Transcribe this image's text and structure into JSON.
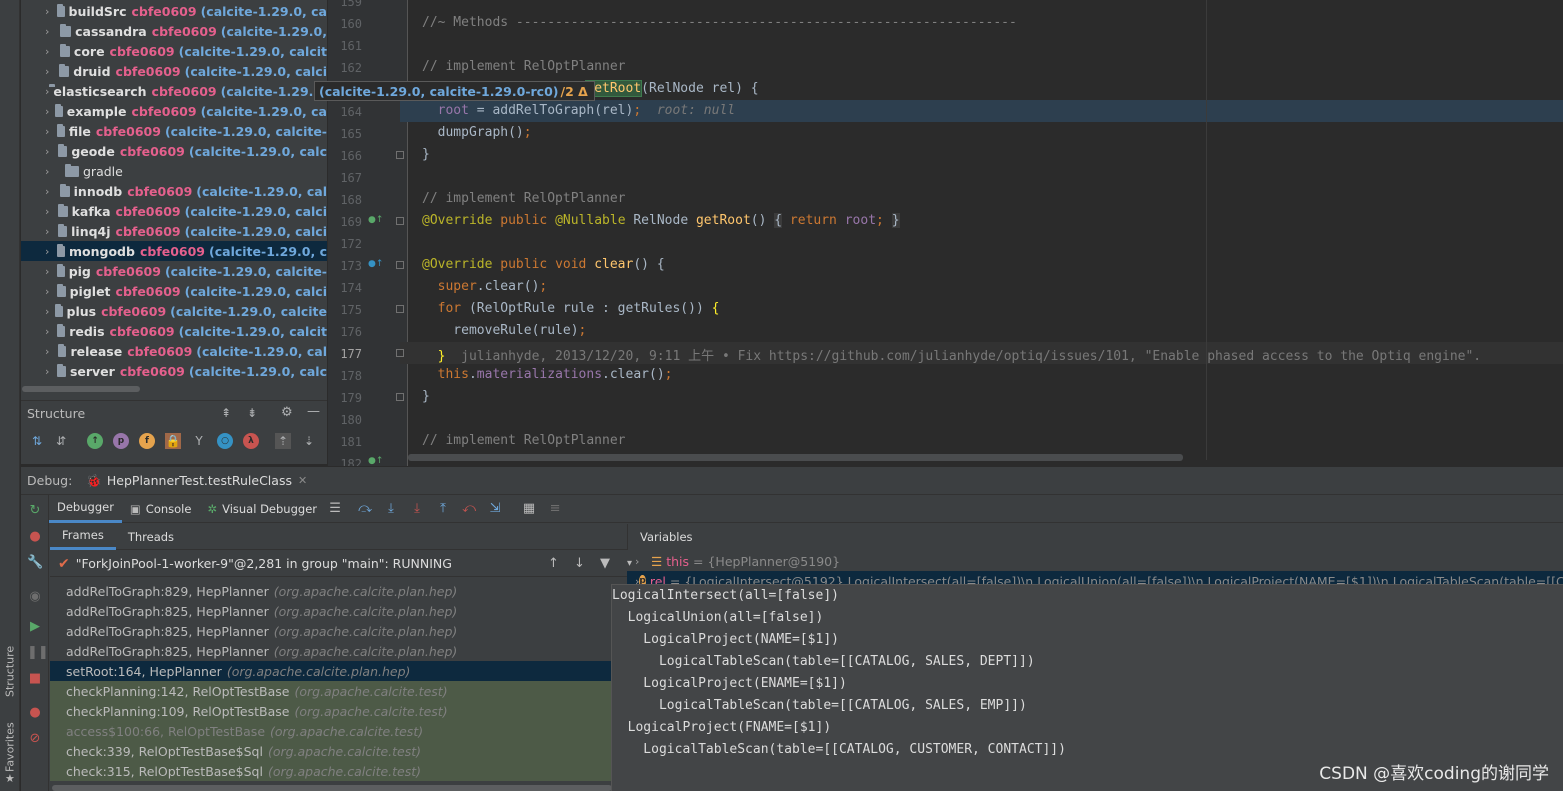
{
  "left_strip": {
    "structure_tab": "Structure",
    "favorites_tab": "Favorites"
  },
  "project": {
    "modules": [
      {
        "name": "buildSrc",
        "hash": "cbfe0609",
        "branch": "(calcite-1.29.0, ca"
      },
      {
        "name": "cassandra",
        "hash": "cbfe0609",
        "branch": "(calcite-1.29.0,"
      },
      {
        "name": "core",
        "hash": "cbfe0609",
        "branch": "(calcite-1.29.0, calcit"
      },
      {
        "name": "druid",
        "hash": "cbfe0609",
        "branch": "(calcite-1.29.0, calci"
      },
      {
        "name": "elasticsearch",
        "hash": "cbfe0609",
        "branch": "(calcite-1.29.0, calcite-1.29.0-rc0)"
      },
      {
        "name": "example",
        "hash": "cbfe0609",
        "branch": "(calcite-1.29.0, ca"
      },
      {
        "name": "file",
        "hash": "cbfe0609",
        "branch": "(calcite-1.29.0, calcite-"
      },
      {
        "name": "geode",
        "hash": "cbfe0609",
        "branch": "(calcite-1.29.0, calc"
      },
      {
        "name": "gradle",
        "hash": "",
        "branch": ""
      },
      {
        "name": "innodb",
        "hash": "cbfe0609",
        "branch": "(calcite-1.29.0, cal"
      },
      {
        "name": "kafka",
        "hash": "cbfe0609",
        "branch": "(calcite-1.29.0, calci"
      },
      {
        "name": "linq4j",
        "hash": "cbfe0609",
        "branch": "(calcite-1.29.0, calci"
      },
      {
        "name": "mongodb",
        "hash": "cbfe0609",
        "branch": "(calcite-1.29.0, c"
      },
      {
        "name": "pig",
        "hash": "cbfe0609",
        "branch": "(calcite-1.29.0, calcite-"
      },
      {
        "name": "piglet",
        "hash": "cbfe0609",
        "branch": "(calcite-1.29.0, calci"
      },
      {
        "name": "plus",
        "hash": "cbfe0609",
        "branch": "(calcite-1.29.0, calcite"
      },
      {
        "name": "redis",
        "hash": "cbfe0609",
        "branch": "(calcite-1.29.0, calcit"
      },
      {
        "name": "release",
        "hash": "cbfe0609",
        "branch": "(calcite-1.29.0, cal"
      },
      {
        "name": "server",
        "hash": "cbfe0609",
        "branch": "(calcite-1.29.0, calc"
      }
    ],
    "tooltip_extra": "/2 Δ"
  },
  "structure": {
    "title": "Structure"
  },
  "editor": {
    "line_numbers": [
      "159",
      "160",
      "161",
      "162",
      "",
      "164",
      "165",
      "166",
      "167",
      "168",
      "169",
      "172",
      "173",
      "174",
      "175",
      "176",
      "177",
      "178",
      "179",
      "180",
      "181",
      "182"
    ],
    "inlay_root": "root: null",
    "blame": "julianhyde, 2013/12/20, 9:11 上午 • Fix https://github.com/julianhyde/optiq/issues/101, \"Enable phased access to the Optiq engine\"."
  },
  "debug": {
    "label": "Debug:",
    "session_tab": "HepPlannerTest.testRuleClass",
    "tabs": [
      "Debugger",
      "Console",
      "Visual Debugger"
    ],
    "frames_tabs": [
      "Frames",
      "Threads"
    ],
    "thread": "\"ForkJoinPool-1-worker-9\"@2,281 in group \"main\": RUNNING",
    "frames": [
      {
        "name": "addRelToGraph:829, HepPlanner",
        "pkg": "(org.apache.calcite.plan.hep)"
      },
      {
        "name": "addRelToGraph:825, HepPlanner",
        "pkg": "(org.apache.calcite.plan.hep)"
      },
      {
        "name": "addRelToGraph:825, HepPlanner",
        "pkg": "(org.apache.calcite.plan.hep)"
      },
      {
        "name": "addRelToGraph:825, HepPlanner",
        "pkg": "(org.apache.calcite.plan.hep)"
      },
      {
        "name": "setRoot:164, HepPlanner",
        "pkg": "(org.apache.calcite.plan.hep)"
      },
      {
        "name": "checkPlanning:142, RelOptTestBase",
        "pkg": "(org.apache.calcite.test)"
      },
      {
        "name": "checkPlanning:109, RelOptTestBase",
        "pkg": "(org.apache.calcite.test)"
      },
      {
        "name": "access$100:66, RelOptTestBase",
        "pkg": "(org.apache.calcite.test)"
      },
      {
        "name": "check:339, RelOptTestBase$Sql",
        "pkg": "(org.apache.calcite.test)"
      },
      {
        "name": "check:315, RelOptTestBase$Sql",
        "pkg": "(org.apache.calcite.test)"
      }
    ],
    "variables_title": "Variables",
    "var_this": {
      "name": "this",
      "value": "= {HepPlanner@5190}"
    },
    "var_rel": {
      "name": "rel",
      "value": "= {LogicalIntersect@5192} LogicalIntersect(all=[false])\\n  LogicalUnion(all=[false])\\n    LogicalProject(NAME=[$1])\\n      LogicalTableScan(table=[[CA"
    },
    "rel_tree": [
      "LogicalIntersect(all=[false])",
      "  LogicalUnion(all=[false])",
      "    LogicalProject(NAME=[$1])",
      "      LogicalTableScan(table=[[CATALOG, SALES, DEPT]])",
      "    LogicalProject(ENAME=[$1])",
      "      LogicalTableScan(table=[[CATALOG, SALES, EMP]])",
      "  LogicalProject(FNAME=[$1])",
      "    LogicalTableScan(table=[[CATALOG, CUSTOMER, CONTACT]])"
    ]
  },
  "watermark": "CSDN @喜欢coding的谢同学"
}
